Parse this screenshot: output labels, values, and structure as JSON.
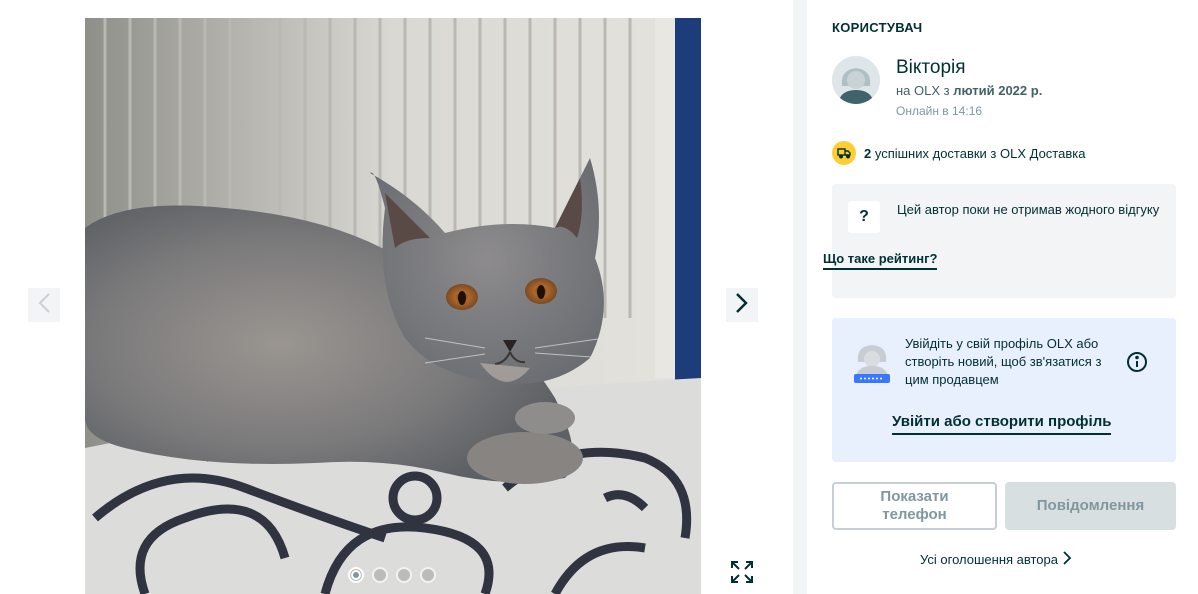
{
  "gallery": {
    "photo_alt": "",
    "prev_icon": "chevron-left-icon",
    "next_icon": "chevron-right-icon",
    "fullscreen_icon": "expand-icon",
    "dots": [
      true,
      false,
      false,
      false
    ]
  },
  "user": {
    "section_title": "КОРИСТУВАЧ",
    "name": "Вікторія",
    "since_prefix": "на OLX з ",
    "since_date": "лютий 2022 р.",
    "online": "Онлайн в 14:16"
  },
  "delivery": {
    "count": "2",
    "text": " успішних доставки з OLX Доставка"
  },
  "rating": {
    "icon": "?",
    "message": "Цей автор поки не отримав жодного відгуку",
    "link": "Що таке рейтинг?"
  },
  "login": {
    "message": "Увійдіть у свій профіль OLX або створіть новий, щоб зв'язатися з цим продавцем",
    "link": "Увійти або створити профіль"
  },
  "actions": {
    "show_phone": "Показати телефон",
    "message": "Повідомлення"
  },
  "all_ads": "Усі оголошення автора",
  "colors": {
    "accent": "#002f34",
    "login_bg": "#e8effd",
    "delivery_badge": "#ffce32"
  }
}
